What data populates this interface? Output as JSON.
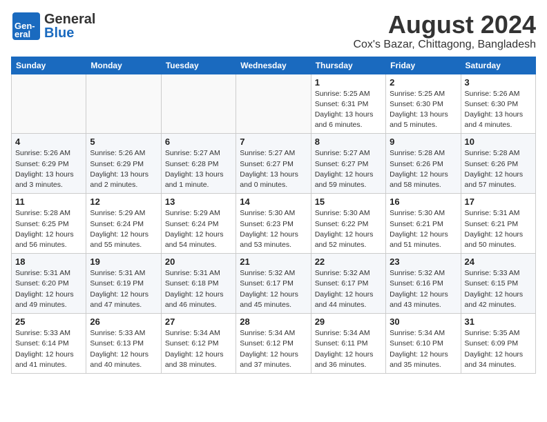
{
  "header": {
    "logo_general": "General",
    "logo_blue": "Blue",
    "month_title": "August 2024",
    "location": "Cox's Bazar, Chittagong, Bangladesh"
  },
  "weekdays": [
    "Sunday",
    "Monday",
    "Tuesday",
    "Wednesday",
    "Thursday",
    "Friday",
    "Saturday"
  ],
  "weeks": [
    [
      {
        "day": "",
        "info": ""
      },
      {
        "day": "",
        "info": ""
      },
      {
        "day": "",
        "info": ""
      },
      {
        "day": "",
        "info": ""
      },
      {
        "day": "1",
        "info": "Sunrise: 5:25 AM\nSunset: 6:31 PM\nDaylight: 13 hours\nand 6 minutes."
      },
      {
        "day": "2",
        "info": "Sunrise: 5:25 AM\nSunset: 6:30 PM\nDaylight: 13 hours\nand 5 minutes."
      },
      {
        "day": "3",
        "info": "Sunrise: 5:26 AM\nSunset: 6:30 PM\nDaylight: 13 hours\nand 4 minutes."
      }
    ],
    [
      {
        "day": "4",
        "info": "Sunrise: 5:26 AM\nSunset: 6:29 PM\nDaylight: 13 hours\nand 3 minutes."
      },
      {
        "day": "5",
        "info": "Sunrise: 5:26 AM\nSunset: 6:29 PM\nDaylight: 13 hours\nand 2 minutes."
      },
      {
        "day": "6",
        "info": "Sunrise: 5:27 AM\nSunset: 6:28 PM\nDaylight: 13 hours\nand 1 minute."
      },
      {
        "day": "7",
        "info": "Sunrise: 5:27 AM\nSunset: 6:27 PM\nDaylight: 13 hours\nand 0 minutes."
      },
      {
        "day": "8",
        "info": "Sunrise: 5:27 AM\nSunset: 6:27 PM\nDaylight: 12 hours\nand 59 minutes."
      },
      {
        "day": "9",
        "info": "Sunrise: 5:28 AM\nSunset: 6:26 PM\nDaylight: 12 hours\nand 58 minutes."
      },
      {
        "day": "10",
        "info": "Sunrise: 5:28 AM\nSunset: 6:26 PM\nDaylight: 12 hours\nand 57 minutes."
      }
    ],
    [
      {
        "day": "11",
        "info": "Sunrise: 5:28 AM\nSunset: 6:25 PM\nDaylight: 12 hours\nand 56 minutes."
      },
      {
        "day": "12",
        "info": "Sunrise: 5:29 AM\nSunset: 6:24 PM\nDaylight: 12 hours\nand 55 minutes."
      },
      {
        "day": "13",
        "info": "Sunrise: 5:29 AM\nSunset: 6:24 PM\nDaylight: 12 hours\nand 54 minutes."
      },
      {
        "day": "14",
        "info": "Sunrise: 5:30 AM\nSunset: 6:23 PM\nDaylight: 12 hours\nand 53 minutes."
      },
      {
        "day": "15",
        "info": "Sunrise: 5:30 AM\nSunset: 6:22 PM\nDaylight: 12 hours\nand 52 minutes."
      },
      {
        "day": "16",
        "info": "Sunrise: 5:30 AM\nSunset: 6:21 PM\nDaylight: 12 hours\nand 51 minutes."
      },
      {
        "day": "17",
        "info": "Sunrise: 5:31 AM\nSunset: 6:21 PM\nDaylight: 12 hours\nand 50 minutes."
      }
    ],
    [
      {
        "day": "18",
        "info": "Sunrise: 5:31 AM\nSunset: 6:20 PM\nDaylight: 12 hours\nand 49 minutes."
      },
      {
        "day": "19",
        "info": "Sunrise: 5:31 AM\nSunset: 6:19 PM\nDaylight: 12 hours\nand 47 minutes."
      },
      {
        "day": "20",
        "info": "Sunrise: 5:31 AM\nSunset: 6:18 PM\nDaylight: 12 hours\nand 46 minutes."
      },
      {
        "day": "21",
        "info": "Sunrise: 5:32 AM\nSunset: 6:17 PM\nDaylight: 12 hours\nand 45 minutes."
      },
      {
        "day": "22",
        "info": "Sunrise: 5:32 AM\nSunset: 6:17 PM\nDaylight: 12 hours\nand 44 minutes."
      },
      {
        "day": "23",
        "info": "Sunrise: 5:32 AM\nSunset: 6:16 PM\nDaylight: 12 hours\nand 43 minutes."
      },
      {
        "day": "24",
        "info": "Sunrise: 5:33 AM\nSunset: 6:15 PM\nDaylight: 12 hours\nand 42 minutes."
      }
    ],
    [
      {
        "day": "25",
        "info": "Sunrise: 5:33 AM\nSunset: 6:14 PM\nDaylight: 12 hours\nand 41 minutes."
      },
      {
        "day": "26",
        "info": "Sunrise: 5:33 AM\nSunset: 6:13 PM\nDaylight: 12 hours\nand 40 minutes."
      },
      {
        "day": "27",
        "info": "Sunrise: 5:34 AM\nSunset: 6:12 PM\nDaylight: 12 hours\nand 38 minutes."
      },
      {
        "day": "28",
        "info": "Sunrise: 5:34 AM\nSunset: 6:12 PM\nDaylight: 12 hours\nand 37 minutes."
      },
      {
        "day": "29",
        "info": "Sunrise: 5:34 AM\nSunset: 6:11 PM\nDaylight: 12 hours\nand 36 minutes."
      },
      {
        "day": "30",
        "info": "Sunrise: 5:34 AM\nSunset: 6:10 PM\nDaylight: 12 hours\nand 35 minutes."
      },
      {
        "day": "31",
        "info": "Sunrise: 5:35 AM\nSunset: 6:09 PM\nDaylight: 12 hours\nand 34 minutes."
      }
    ]
  ]
}
